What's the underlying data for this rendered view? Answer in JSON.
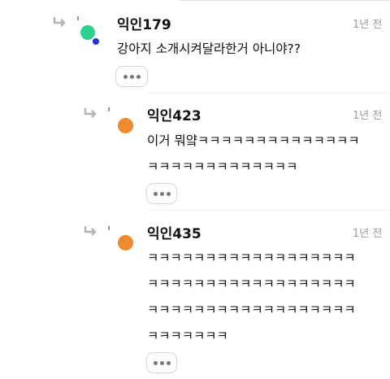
{
  "colors": {
    "avatar_green": "#2ecf8f",
    "avatar_orange": "#f08a31",
    "online_dot_blue": "#2330d6",
    "text_primary": "#111111",
    "text_muted": "#9a9a9a",
    "divider": "#ececec"
  },
  "icons": {
    "reply": "reply-arrow-icon",
    "more": "more-options-icon",
    "online": "online-status-dot"
  },
  "comments": [
    {
      "username": "익인179",
      "timestamp": "1년 전",
      "lines": [
        "강아지 소개시켜달라한거 아니야??"
      ],
      "avatar_color": "#2ecf8f",
      "online": true
    },
    {
      "username": "익인423",
      "timestamp": "1년 전",
      "lines": [
        "이거 뭐얔ㅋㅋㅋㅋㅋㅋㅋㅋㅋㅋㅋㅋㅋㅋ",
        "ㅋㅋㅋㅋㅋㅋㅋㅋㅋㅋㅋㅋㅋ"
      ],
      "avatar_color": "#f08a31",
      "online": false
    },
    {
      "username": "익인435",
      "timestamp": "1년 전",
      "lines": [
        "ㅋㅋㅋㅋㅋㅋㅋㅋㅋㅋㅋㅋㅋㅋㅋㅋㅋㅋ",
        "ㅋㅋㅋㅋㅋㅋㅋㅋㅋㅋㅋㅋㅋㅋㅋㅋㅋㅋ",
        "ㅋㅋㅋㅋㅋㅋㅋㅋㅋㅋㅋㅋㅋㅋㅋㅋㅋㅋ",
        "ㅋㅋㅋㅋㅋㅋㅋ"
      ],
      "avatar_color": "#f08a31",
      "online": false
    }
  ]
}
